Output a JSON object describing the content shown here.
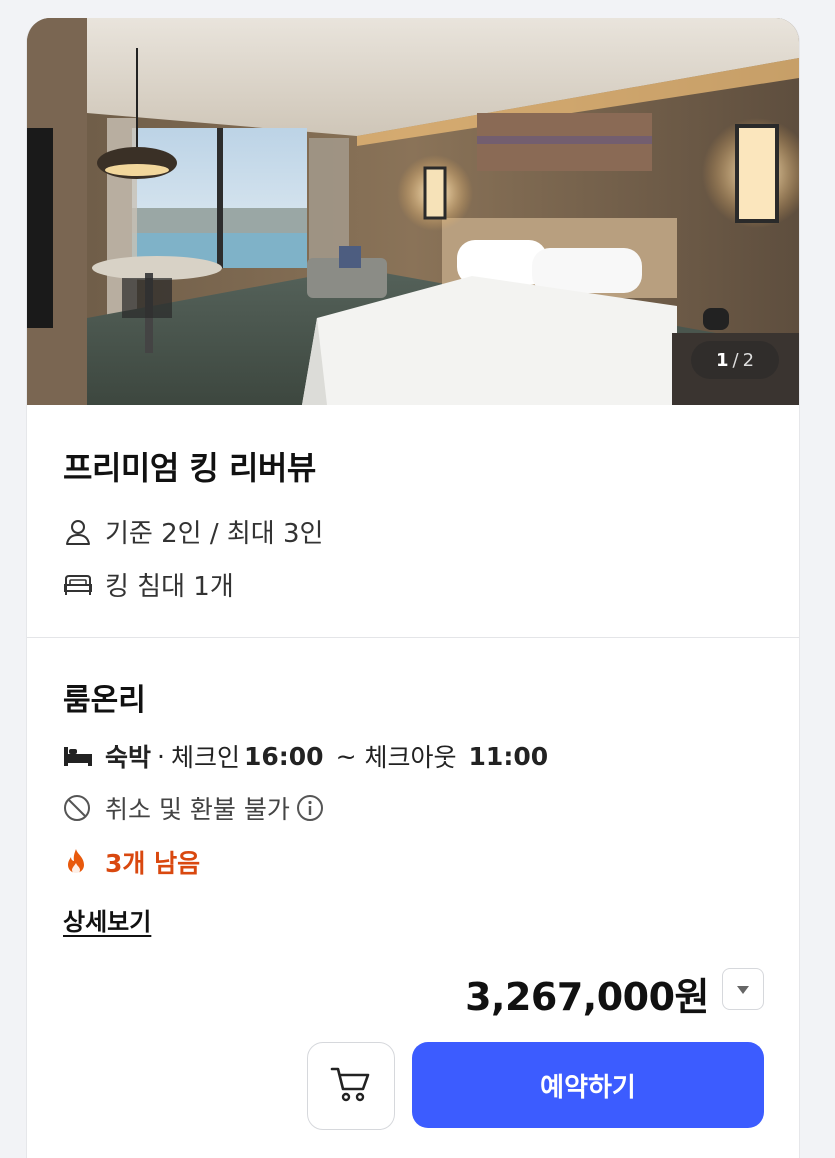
{
  "gallery": {
    "current": "1",
    "separator": "/",
    "total": "2",
    "image_description_icon": "hotel-room-photo"
  },
  "room": {
    "name": "프리미엄 킹 리버뷰",
    "capacity": "기준 2인 / 최대 3인",
    "capacity_icon": "person-icon",
    "bed": "킹 침대 1개",
    "bed_icon": "bed-icon"
  },
  "plan": {
    "name": "룸온리",
    "stay_type": "숙박",
    "dot": "·",
    "checkin_label": "체크인",
    "checkin_time": "16:00",
    "tilde": "~",
    "checkout_label": "체크아웃",
    "checkout_time": "11:00",
    "cancel_policy": "취소 및 환불 불가",
    "stock": "3개 남음",
    "detail_link": "상세보기"
  },
  "price": {
    "amount": "3,267,000원"
  },
  "actions": {
    "book_label": "예약하기"
  },
  "colors": {
    "primary": "#3c5cff",
    "stock_warning": "#d9480f"
  }
}
